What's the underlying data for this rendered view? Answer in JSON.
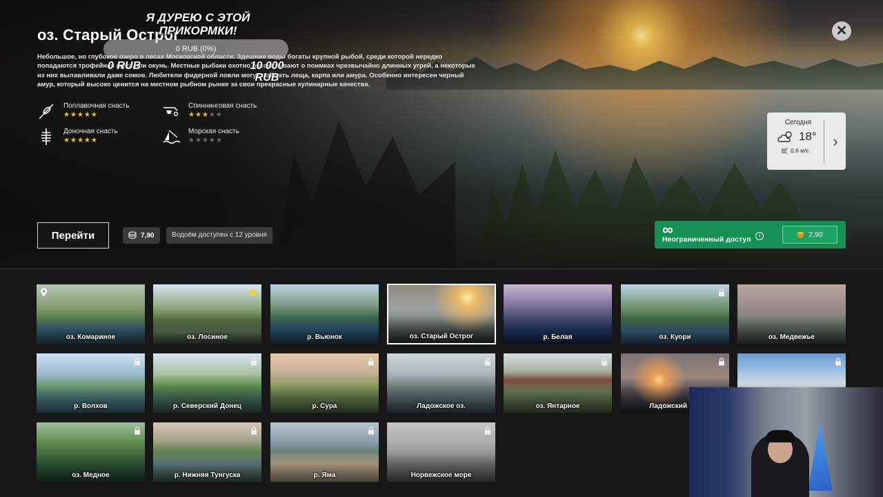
{
  "location": {
    "title": "оз. Старый Острог",
    "description": "Небольшое, но глубокое озеро в лесах Московской области. Здешние воды богаты крупной рыбой, среди которой нередко попадаются трофейная щука или окунь. Местные рыбаки охотно рассказывают о поимках чрезвычайно длинных угрей, а некоторые из них вылавливали даже сомов. Любители фидерной ловли могут поймать леща, карпа или амура. Особенно интересен черный амур, который высоко ценится на местном рыбном рынке за свои прекрасные кулинарные качества."
  },
  "tackle": [
    {
      "name": "Поплавочная снасть",
      "icon": "float-rod-icon",
      "rating": 5
    },
    {
      "name": "Спиннинговая снасть",
      "icon": "spinning-rod-icon",
      "rating": 2.5
    },
    {
      "name": "Доночная снасть",
      "icon": "bottom-rod-icon",
      "rating": 5
    },
    {
      "name": "Морская снасть",
      "icon": "sea-rod-icon",
      "rating": 0
    }
  ],
  "overlay": {
    "title": "Я ДУРЕЮ С ЭТОЙ ПРИКОРМКИ!",
    "donation_status": "0 RUB (0%)",
    "donation_min": "0 RUB",
    "donation_max": "10 000 RUB"
  },
  "weather": {
    "label": "Сегодня",
    "temperature": "18°",
    "wind": "0,6 м/с",
    "icon": "cloud-sun-icon"
  },
  "actions": {
    "go_label": "Перейти",
    "price": "7,90",
    "level_text": "Водоём доступен с 12 уровня",
    "unlimited_label": "Неограниченный доступ",
    "unlimited_symbol": "∞",
    "unlimited_price": "2,90",
    "close_symbol": "✕",
    "weather_next_symbol": "›"
  },
  "colors": {
    "accent_green": "#168f55",
    "star_gold": "#f3c319",
    "home_yellow": "#f2d23a"
  },
  "locations": [
    {
      "name": "оз. Комариное",
      "status": "current"
    },
    {
      "name": "оз. Лосиное",
      "status": "home"
    },
    {
      "name": "р. Вьюнок",
      "status": "open"
    },
    {
      "name": "оз. Старый Острог",
      "status": "selected"
    },
    {
      "name": "р. Белая",
      "status": "open"
    },
    {
      "name": "оз. Куори",
      "status": "locked"
    },
    {
      "name": "оз. Медвежье",
      "status": "open"
    },
    {
      "name": "р. Волхов",
      "status": "locked"
    },
    {
      "name": "р. Северский Донец",
      "status": "locked"
    },
    {
      "name": "р. Сура",
      "status": "locked"
    },
    {
      "name": "Ладожское оз.",
      "status": "locked"
    },
    {
      "name": "оз. Янтарное",
      "status": "locked"
    },
    {
      "name": "Ладожский арх",
      "status": "locked"
    },
    {
      "name": "",
      "status": "locked"
    },
    {
      "name": "оз. Медное",
      "status": "locked"
    },
    {
      "name": "р. Нижняя Тунгуска",
      "status": "locked"
    },
    {
      "name": "р. Яма",
      "status": "locked"
    },
    {
      "name": "Норвежское море",
      "status": "locked"
    }
  ]
}
